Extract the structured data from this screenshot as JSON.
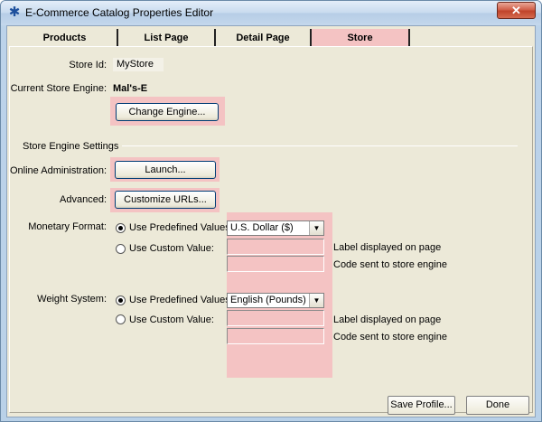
{
  "window": {
    "title": "E-Commerce Catalog Properties Editor",
    "close_glyph": "✕"
  },
  "tabs": [
    {
      "label": "Products"
    },
    {
      "label": "List Page"
    },
    {
      "label": "Detail Page"
    },
    {
      "label": "Store",
      "active": true
    }
  ],
  "store": {
    "store_id_label": "Store Id:",
    "store_id_value": "MyStore",
    "engine_label": "Current Store Engine:",
    "engine_value": "Mal's-E",
    "change_engine_button": "Change Engine...",
    "settings_section": "Store Engine Settings",
    "online_admin_label": "Online Administration:",
    "launch_button": "Launch...",
    "advanced_label": "Advanced:",
    "customize_urls_button": "Customize URLs..."
  },
  "monetary": {
    "label": "Monetary Format:",
    "predefined_label": "Use Predefined Values:",
    "predefined_selected": true,
    "predefined_value": "U.S. Dollar ($)",
    "custom_label": "Use Custom Value:",
    "display_label": "Label displayed on page",
    "code_label": "Code sent to store engine",
    "display_value": "",
    "code_value": ""
  },
  "weight": {
    "label": "Weight System:",
    "predefined_label": "Use Predefined Values:",
    "predefined_selected": true,
    "predefined_value": "English (Pounds)",
    "custom_label": "Use Custom Value:",
    "display_label": "Label displayed on page",
    "code_label": "Code sent to store engine",
    "display_value": "",
    "code_value": ""
  },
  "footer": {
    "save_profile_button": "Save Profile...",
    "done_button": "Done"
  },
  "colors": {
    "highlight": "#f4c3c3",
    "dialog_background": "#ece9d8"
  }
}
